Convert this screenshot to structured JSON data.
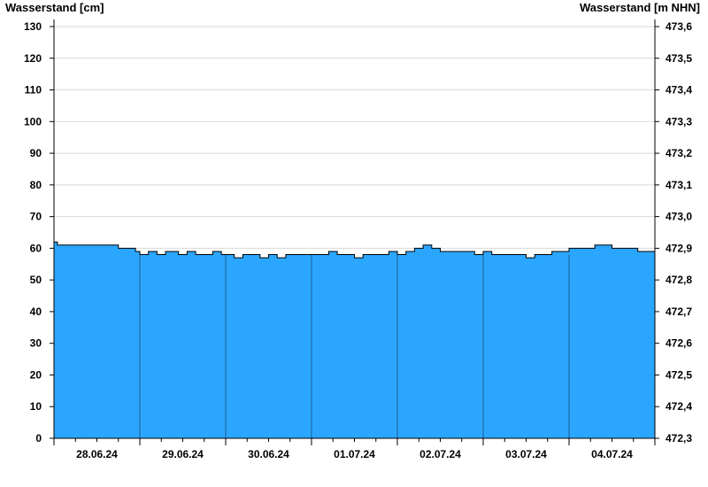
{
  "chart_data": {
    "type": "area",
    "ylabel_left": "Wasserstand [cm]",
    "ylabel_right": "Wasserstand [m NHN]",
    "ylim_left": [
      0,
      130
    ],
    "ylim_right": [
      472.3,
      473.6
    ],
    "yticks_left": [
      "0",
      "10",
      "20",
      "30",
      "40",
      "50",
      "60",
      "70",
      "80",
      "90",
      "100",
      "110",
      "120",
      "130"
    ],
    "yticks_right": [
      "472,3",
      "472,4",
      "472,5",
      "472,6",
      "472,7",
      "472,8",
      "472,9",
      "473,0",
      "473,1",
      "473,2",
      "473,3",
      "473,4",
      "473,5",
      "473,6"
    ],
    "x_categories": [
      "28.06.24",
      "29.06.24",
      "30.06.24",
      "01.07.24",
      "02.07.24",
      "03.07.24",
      "04.07.24"
    ],
    "xlim_days": [
      0,
      7
    ],
    "grid": true,
    "fill_color": "#2ba6ff",
    "line_color": "#000000",
    "series": [
      {
        "x_days": [
          0,
          0.04,
          0.1,
          0.3,
          0.5,
          0.7,
          0.75,
          0.85,
          0.95,
          1.0,
          1.1,
          1.2,
          1.3,
          1.4,
          1.45,
          1.55,
          1.65,
          1.75,
          1.85,
          1.95,
          2.0,
          2.1,
          2.2,
          2.3,
          2.4,
          2.5,
          2.6,
          2.7,
          2.8,
          2.95,
          3.0,
          3.1,
          3.2,
          3.3,
          3.4,
          3.5,
          3.6,
          3.7,
          3.8,
          3.9,
          4.0,
          4.1,
          4.2,
          4.3,
          4.4,
          4.5,
          4.6,
          4.7,
          4.8,
          4.9,
          5.0,
          5.1,
          5.2,
          5.3,
          5.4,
          5.5,
          5.6,
          5.7,
          5.8,
          5.9,
          6.0,
          6.1,
          6.2,
          6.3,
          6.4,
          6.5,
          6.6,
          6.7,
          6.8,
          6.9,
          7.0
        ],
        "values": [
          62,
          61,
          61,
          61,
          61,
          61,
          60,
          60,
          59,
          58,
          59,
          58,
          59,
          59,
          58,
          59,
          58,
          58,
          59,
          58,
          58,
          57,
          58,
          58,
          57,
          58,
          57,
          58,
          58,
          58,
          58,
          58,
          59,
          58,
          58,
          57,
          58,
          58,
          58,
          59,
          58,
          59,
          60,
          61,
          60,
          59,
          59,
          59,
          59,
          58,
          59,
          58,
          58,
          58,
          58,
          57,
          58,
          58,
          59,
          59,
          60,
          60,
          60,
          61,
          61,
          60,
          60,
          60,
          59,
          59,
          57
        ]
      }
    ]
  }
}
